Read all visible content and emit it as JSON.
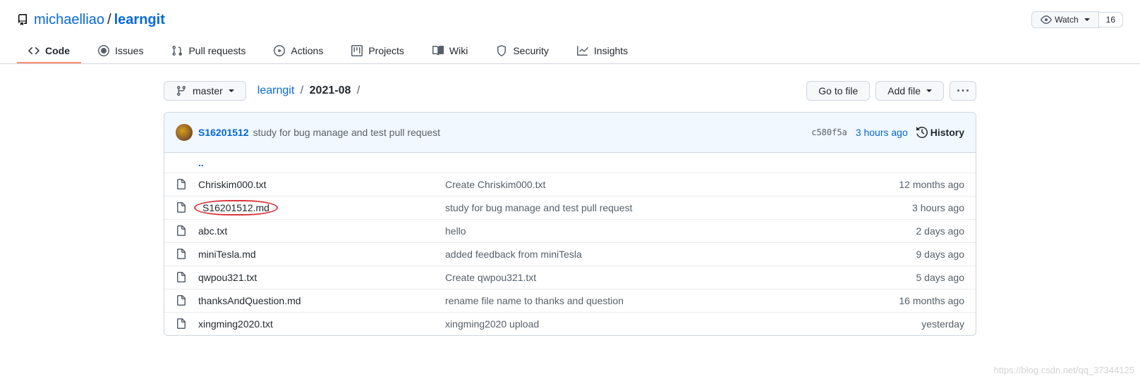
{
  "repo": {
    "owner": "michaelliao",
    "name": "learngit"
  },
  "watch": {
    "label": "Watch",
    "count": "16"
  },
  "tabs": {
    "code": "Code",
    "issues": "Issues",
    "pulls": "Pull requests",
    "actions": "Actions",
    "projects": "Projects",
    "wiki": "Wiki",
    "security": "Security",
    "insights": "Insights"
  },
  "branch": {
    "label": "master"
  },
  "breadcrumb": {
    "root": "learngit",
    "path": "2021-08"
  },
  "actions": {
    "go_to_file": "Go to file",
    "add_file": "Add file"
  },
  "last_commit": {
    "author": "S16201512",
    "message": "study for bug manage and test pull request",
    "sha": "c580f5a",
    "age": "3 hours ago",
    "history_label": "History"
  },
  "updir": "..",
  "files": [
    {
      "name": "Chriskim000.txt",
      "msg": "Create Chriskim000.txt",
      "age": "12 months ago",
      "highlight": false
    },
    {
      "name": "S16201512.md",
      "msg": "study for bug manage and test pull request",
      "age": "3 hours ago",
      "highlight": true
    },
    {
      "name": "abc.txt",
      "msg": "hello",
      "age": "2 days ago",
      "highlight": false
    },
    {
      "name": "miniTesla.md",
      "msg": "added feedback from miniTesla",
      "age": "9 days ago",
      "highlight": false
    },
    {
      "name": "qwpou321.txt",
      "msg": "Create qwpou321.txt",
      "age": "5 days ago",
      "highlight": false
    },
    {
      "name": "thanksAndQuestion.md",
      "msg": "rename file name to thanks and question",
      "age": "16 months ago",
      "highlight": false
    },
    {
      "name": "xingming2020.txt",
      "msg": "xingming2020 upload",
      "age": "yesterday",
      "highlight": false
    }
  ],
  "watermark": "https://blog.csdn.net/qq_37344125"
}
